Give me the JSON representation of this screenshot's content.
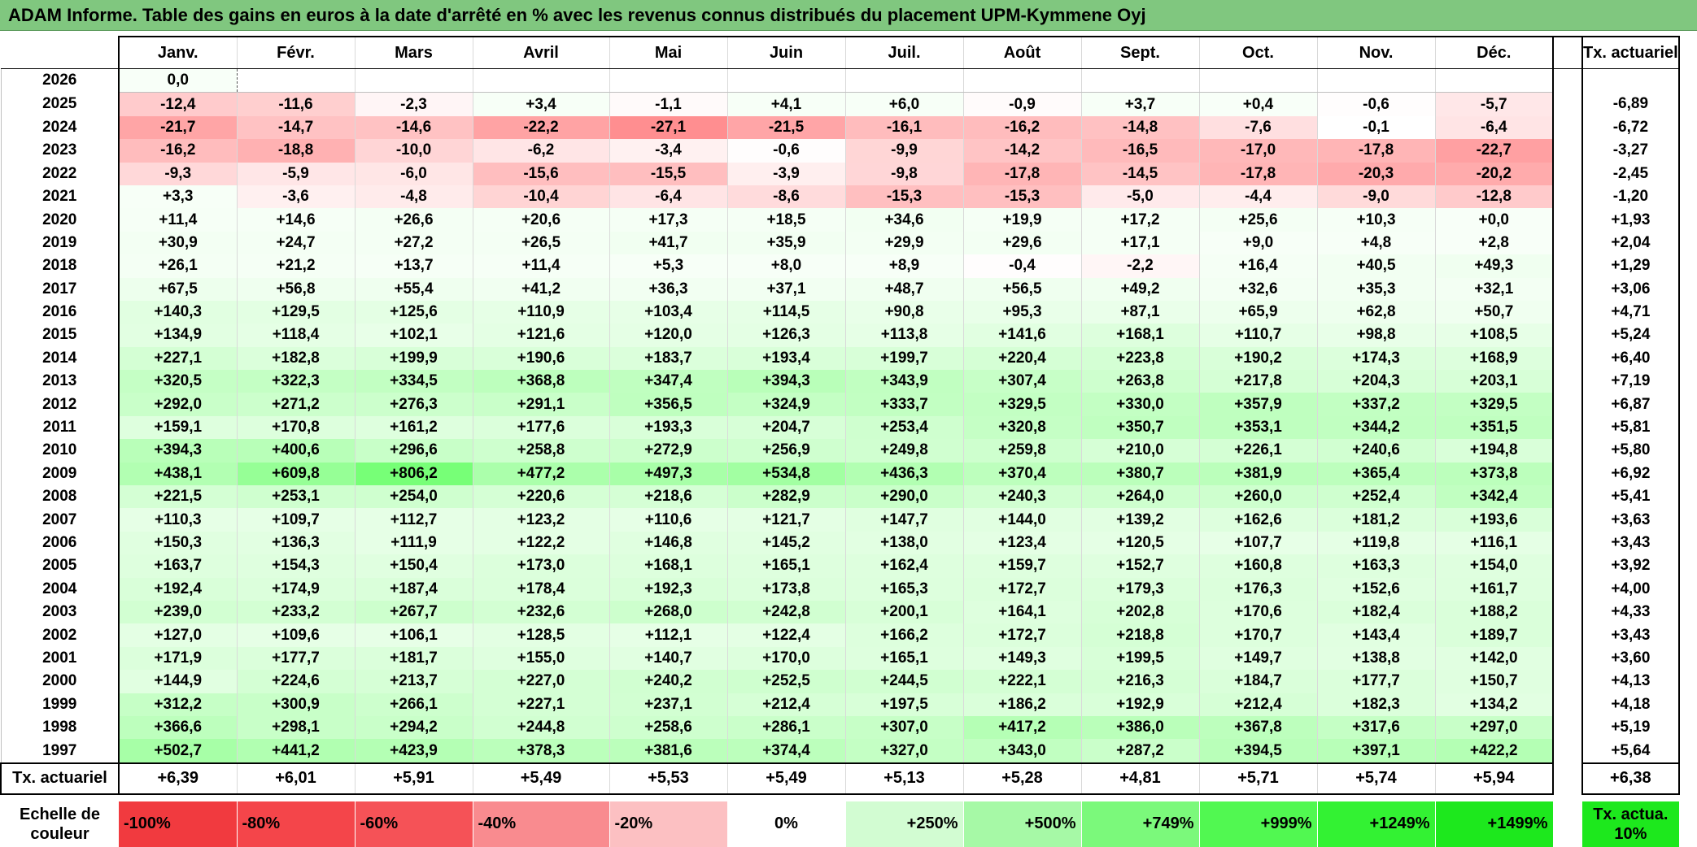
{
  "title": "ADAM Informe. Table des gains en euros à la date d'arrêté en % avec les revenus connus distribués du placement UPM-Kymmene Oyj",
  "months": [
    "Janv.",
    "Févr.",
    "Mars",
    "Avril",
    "Mai",
    "Juin",
    "Juil.",
    "Août",
    "Sept.",
    "Oct.",
    "Nov.",
    "Déc."
  ],
  "tx_header": "Tx. actuariel",
  "rows": [
    {
      "year": "2026",
      "values": [
        "0,0",
        "",
        "",
        "",
        "",
        "",
        "",
        "",
        "",
        "",
        "",
        ""
      ],
      "tx": ""
    },
    {
      "year": "2025",
      "values": [
        "-12,4",
        "-11,6",
        "-2,3",
        "+3,4",
        "-1,1",
        "+4,1",
        "+6,0",
        "-0,9",
        "+3,7",
        "+0,4",
        "-0,6",
        "-5,7"
      ],
      "tx": "-6,89"
    },
    {
      "year": "2024",
      "values": [
        "-21,7",
        "-14,7",
        "-14,6",
        "-22,2",
        "-27,1",
        "-21,5",
        "-16,1",
        "-16,2",
        "-14,8",
        "-7,6",
        "-0,1",
        "-6,4"
      ],
      "tx": "-6,72"
    },
    {
      "year": "2023",
      "values": [
        "-16,2",
        "-18,8",
        "-10,0",
        "-6,2",
        "-3,4",
        "-0,6",
        "-9,9",
        "-14,2",
        "-16,5",
        "-17,0",
        "-17,8",
        "-22,7"
      ],
      "tx": "-3,27"
    },
    {
      "year": "2022",
      "values": [
        "-9,3",
        "-5,9",
        "-6,0",
        "-15,6",
        "-15,5",
        "-3,9",
        "-9,8",
        "-17,8",
        "-14,5",
        "-17,8",
        "-20,3",
        "-20,2"
      ],
      "tx": "-2,45"
    },
    {
      "year": "2021",
      "values": [
        "+3,3",
        "-3,6",
        "-4,8",
        "-10,4",
        "-6,4",
        "-8,6",
        "-15,3",
        "-15,3",
        "-5,0",
        "-4,4",
        "-9,0",
        "-12,8"
      ],
      "tx": "-1,20"
    },
    {
      "year": "2020",
      "values": [
        "+11,4",
        "+14,6",
        "+26,6",
        "+20,6",
        "+17,3",
        "+18,5",
        "+34,6",
        "+19,9",
        "+17,2",
        "+25,6",
        "+10,3",
        "+0,0"
      ],
      "tx": "+1,93"
    },
    {
      "year": "2019",
      "values": [
        "+30,9",
        "+24,7",
        "+27,2",
        "+26,5",
        "+41,7",
        "+35,9",
        "+29,9",
        "+29,6",
        "+17,1",
        "+9,0",
        "+4,8",
        "+2,8"
      ],
      "tx": "+2,04"
    },
    {
      "year": "2018",
      "values": [
        "+26,1",
        "+21,2",
        "+13,7",
        "+11,4",
        "+5,3",
        "+8,0",
        "+8,9",
        "-0,4",
        "-2,2",
        "+16,4",
        "+40,5",
        "+49,3"
      ],
      "tx": "+1,29"
    },
    {
      "year": "2017",
      "values": [
        "+67,5",
        "+56,8",
        "+55,4",
        "+41,2",
        "+36,3",
        "+37,1",
        "+48,7",
        "+56,5",
        "+49,2",
        "+32,6",
        "+35,3",
        "+32,1"
      ],
      "tx": "+3,06"
    },
    {
      "year": "2016",
      "values": [
        "+140,3",
        "+129,5",
        "+125,6",
        "+110,9",
        "+103,4",
        "+114,5",
        "+90,8",
        "+95,3",
        "+87,1",
        "+65,9",
        "+62,8",
        "+50,7"
      ],
      "tx": "+4,71"
    },
    {
      "year": "2015",
      "values": [
        "+134,9",
        "+118,4",
        "+102,1",
        "+121,6",
        "+120,0",
        "+126,3",
        "+113,8",
        "+141,6",
        "+168,1",
        "+110,7",
        "+98,8",
        "+108,5"
      ],
      "tx": "+5,24"
    },
    {
      "year": "2014",
      "values": [
        "+227,1",
        "+182,8",
        "+199,9",
        "+190,6",
        "+183,7",
        "+193,4",
        "+199,7",
        "+220,4",
        "+223,8",
        "+190,2",
        "+174,3",
        "+168,9"
      ],
      "tx": "+6,40"
    },
    {
      "year": "2013",
      "values": [
        "+320,5",
        "+322,3",
        "+334,5",
        "+368,8",
        "+347,4",
        "+394,3",
        "+343,9",
        "+307,4",
        "+263,8",
        "+217,8",
        "+204,3",
        "+203,1"
      ],
      "tx": "+7,19"
    },
    {
      "year": "2012",
      "values": [
        "+292,0",
        "+271,2",
        "+276,3",
        "+291,1",
        "+356,5",
        "+324,9",
        "+333,7",
        "+329,5",
        "+330,0",
        "+357,9",
        "+337,2",
        "+329,5"
      ],
      "tx": "+6,87"
    },
    {
      "year": "2011",
      "values": [
        "+159,1",
        "+170,8",
        "+161,2",
        "+177,6",
        "+193,3",
        "+204,7",
        "+253,4",
        "+320,8",
        "+350,7",
        "+353,1",
        "+344,2",
        "+351,5"
      ],
      "tx": "+5,81"
    },
    {
      "year": "2010",
      "values": [
        "+394,3",
        "+400,6",
        "+296,6",
        "+258,8",
        "+272,9",
        "+256,9",
        "+249,8",
        "+259,8",
        "+210,0",
        "+226,1",
        "+240,6",
        "+194,8"
      ],
      "tx": "+5,80"
    },
    {
      "year": "2009",
      "values": [
        "+438,1",
        "+609,8",
        "+806,2",
        "+477,2",
        "+497,3",
        "+534,8",
        "+436,3",
        "+370,4",
        "+380,7",
        "+381,9",
        "+365,4",
        "+373,8"
      ],
      "tx": "+6,92"
    },
    {
      "year": "2008",
      "values": [
        "+221,5",
        "+253,1",
        "+254,0",
        "+220,6",
        "+218,6",
        "+282,9",
        "+290,0",
        "+240,3",
        "+264,0",
        "+260,0",
        "+252,4",
        "+342,4"
      ],
      "tx": "+5,41"
    },
    {
      "year": "2007",
      "values": [
        "+110,3",
        "+109,7",
        "+112,7",
        "+123,2",
        "+110,6",
        "+121,7",
        "+147,7",
        "+144,0",
        "+139,2",
        "+162,6",
        "+181,2",
        "+193,6"
      ],
      "tx": "+3,63"
    },
    {
      "year": "2006",
      "values": [
        "+150,3",
        "+136,3",
        "+111,9",
        "+122,2",
        "+146,8",
        "+145,2",
        "+138,0",
        "+123,4",
        "+120,5",
        "+107,7",
        "+119,8",
        "+116,1"
      ],
      "tx": "+3,43"
    },
    {
      "year": "2005",
      "values": [
        "+163,7",
        "+154,3",
        "+150,4",
        "+173,0",
        "+168,1",
        "+165,1",
        "+162,4",
        "+159,7",
        "+152,7",
        "+160,8",
        "+163,3",
        "+154,0"
      ],
      "tx": "+3,92"
    },
    {
      "year": "2004",
      "values": [
        "+192,4",
        "+174,9",
        "+187,4",
        "+178,4",
        "+192,3",
        "+173,8",
        "+165,3",
        "+172,7",
        "+179,3",
        "+176,3",
        "+152,6",
        "+161,7"
      ],
      "tx": "+4,00"
    },
    {
      "year": "2003",
      "values": [
        "+239,0",
        "+233,2",
        "+267,7",
        "+232,6",
        "+268,0",
        "+242,8",
        "+200,1",
        "+164,1",
        "+202,8",
        "+170,6",
        "+182,4",
        "+188,2"
      ],
      "tx": "+4,33"
    },
    {
      "year": "2002",
      "values": [
        "+127,0",
        "+109,6",
        "+106,1",
        "+128,5",
        "+112,1",
        "+122,4",
        "+166,2",
        "+172,7",
        "+218,8",
        "+170,7",
        "+143,4",
        "+189,7"
      ],
      "tx": "+3,43"
    },
    {
      "year": "2001",
      "values": [
        "+171,9",
        "+177,7",
        "+181,7",
        "+155,0",
        "+140,7",
        "+170,0",
        "+165,1",
        "+149,3",
        "+199,5",
        "+149,7",
        "+138,8",
        "+142,0"
      ],
      "tx": "+3,60"
    },
    {
      "year": "2000",
      "values": [
        "+144,9",
        "+224,6",
        "+213,7",
        "+227,0",
        "+240,2",
        "+252,5",
        "+244,5",
        "+222,1",
        "+216,3",
        "+184,7",
        "+177,7",
        "+150,7"
      ],
      "tx": "+4,13"
    },
    {
      "year": "1999",
      "values": [
        "+312,2",
        "+300,9",
        "+266,1",
        "+227,1",
        "+237,1",
        "+212,4",
        "+197,5",
        "+186,2",
        "+192,9",
        "+212,4",
        "+182,3",
        "+134,2"
      ],
      "tx": "+4,18"
    },
    {
      "year": "1998",
      "values": [
        "+366,6",
        "+298,1",
        "+294,2",
        "+244,8",
        "+258,6",
        "+286,1",
        "+307,0",
        "+417,2",
        "+386,0",
        "+367,8",
        "+317,6",
        "+297,0"
      ],
      "tx": "+5,19"
    },
    {
      "year": "1997",
      "values": [
        "+502,7",
        "+441,2",
        "+423,9",
        "+378,3",
        "+381,6",
        "+374,4",
        "+327,0",
        "+343,0",
        "+287,2",
        "+394,5",
        "+397,1",
        "+422,2"
      ],
      "tx": "+5,64"
    }
  ],
  "tx_row": {
    "label": "Tx. actuariel",
    "values": [
      "+6,39",
      "+6,01",
      "+5,91",
      "+5,49",
      "+5,53",
      "+5,49",
      "+5,13",
      "+5,28",
      "+4,81",
      "+5,71",
      "+5,74",
      "+5,94"
    ],
    "total": "+6,38"
  },
  "scale": {
    "label": "Echelle de couleur",
    "items": [
      {
        "text": "-100%",
        "color": "#f13a3f"
      },
      {
        "text": "-80%",
        "color": "#f4454a"
      },
      {
        "text": "-60%",
        "color": "#f55257"
      },
      {
        "text": "-40%",
        "color": "#f98b8f"
      },
      {
        "text": "-20%",
        "color": "#fcc0c2"
      },
      {
        "text": "0%",
        "color": "#ffffff"
      },
      {
        "text": "+250%",
        "color": "#d2fcd2"
      },
      {
        "text": "+500%",
        "color": "#a6f9a6"
      },
      {
        "text": "+749%",
        "color": "#7bf97b"
      },
      {
        "text": "+999%",
        "color": "#51f851"
      },
      {
        "text": "+1249%",
        "color": "#33f233"
      },
      {
        "text": "+1499%",
        "color": "#1de81d"
      }
    ],
    "tx_legend": "Tx. actua. 10%",
    "tx_legend_color": "#1de81d"
  }
}
